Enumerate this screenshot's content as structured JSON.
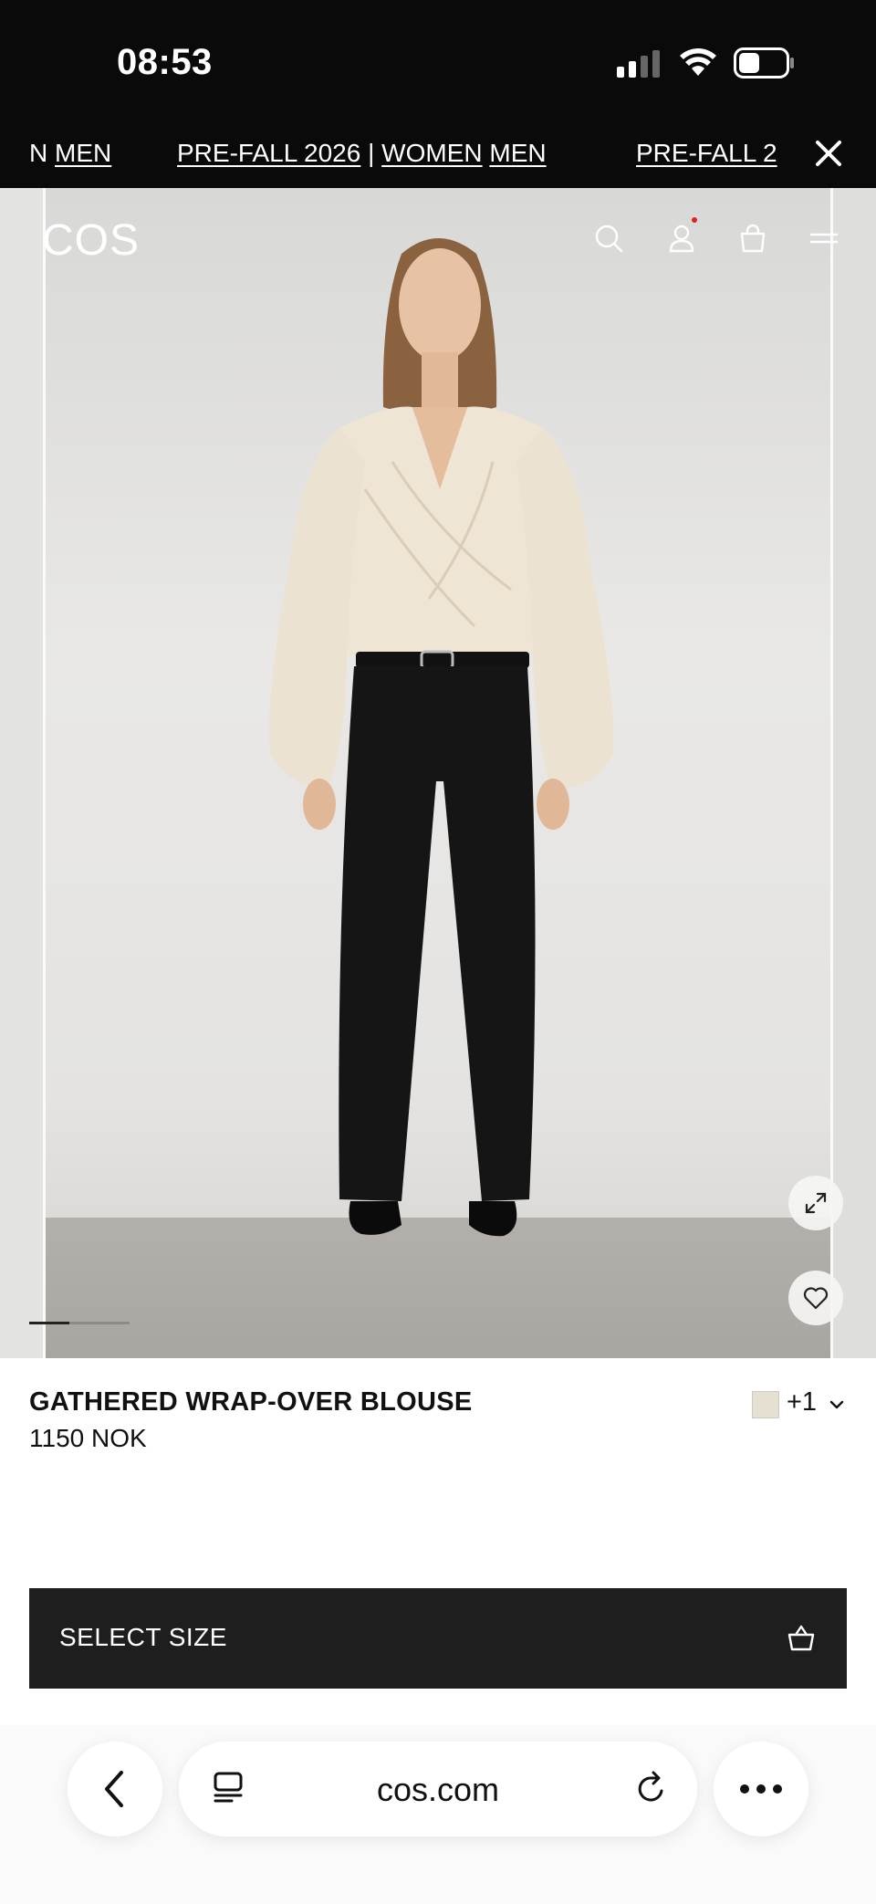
{
  "status_bar": {
    "time": "08:53",
    "icons": [
      "signal-icon",
      "wifi-icon",
      "battery-icon"
    ]
  },
  "promo_banner": {
    "items": [
      {
        "text_a": "N",
        "link_b": "MEN"
      },
      {
        "text_a": "PRE-FALL 2026",
        "sep": "|",
        "link_b": "WOMEN",
        "link_c": "MEN"
      },
      {
        "text_a": "PRE-FALL 2"
      }
    ],
    "close_icon": "close-icon"
  },
  "header": {
    "logo": "COS",
    "icons": [
      "search-icon",
      "account-icon",
      "bag-icon",
      "menu-icon"
    ]
  },
  "gallery": {
    "expand_icon": "expand-icon",
    "favorite_icon": "heart-icon",
    "active_slide_fraction": 0.4
  },
  "product": {
    "name": "GATHERED WRAP-OVER BLOUSE",
    "price": "1150 NOK",
    "color_more": "+1",
    "swatch_color": "#e6e0d3"
  },
  "cta": {
    "select_size": "SELECT SIZE"
  },
  "browser": {
    "url": "cos.com",
    "back_icon": "back-icon",
    "tabs_icon": "tabs-icon",
    "reload_icon": "reload-icon",
    "more_icon": "more-icon"
  },
  "colors": {
    "chrome_black": "#0a0a0a",
    "button_dark": "#1e1e1e",
    "blouse": "#eee5d5",
    "trousers": "#151515"
  }
}
